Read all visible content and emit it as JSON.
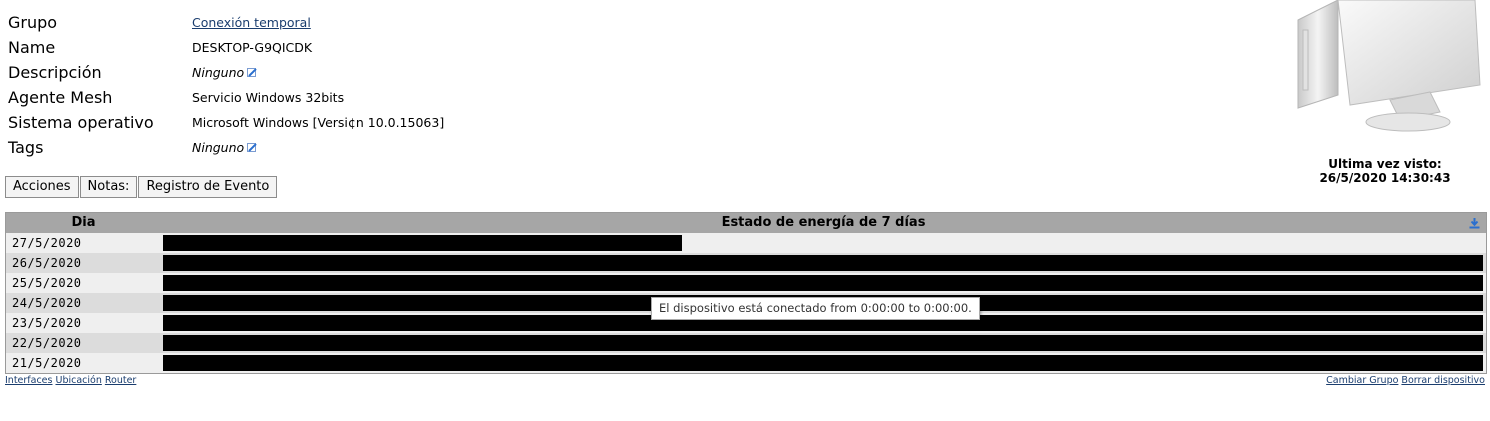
{
  "info": {
    "rows": [
      {
        "label": "Grupo",
        "value": "Conexión temporal"
      },
      {
        "label": "Name",
        "value": "DESKTOP-G9QICDK"
      },
      {
        "label": "Descripción",
        "value": "Ninguno"
      },
      {
        "label": "Agente Mesh",
        "value": "Servicio Windows 32bits"
      },
      {
        "label": "Sistema operativo",
        "value": "Microsoft Windows [Versi¢n 10.0.15063]"
      },
      {
        "label": "Tags",
        "value": "Ninguno"
      }
    ]
  },
  "device_icon": "computer-monitor-icon",
  "last_seen": {
    "label": "Ultima vez visto:",
    "value": "26/5/2020 14:30:43"
  },
  "tabs": {
    "actions": "Acciones",
    "notes": "Notas:",
    "events": "Registro de Evento"
  },
  "power": {
    "day_header": "Dia",
    "title": "Estado de energía de 7 días",
    "download_icon": "download-icon",
    "bar_color": "#000000",
    "days": [
      {
        "date": "27/5/2020",
        "on_fraction": 0.393
      },
      {
        "date": "26/5/2020",
        "on_fraction": 1.0
      },
      {
        "date": "25/5/2020",
        "on_fraction": 1.0
      },
      {
        "date": "24/5/2020",
        "on_fraction": 1.0
      },
      {
        "date": "23/5/2020",
        "on_fraction": 1.0
      },
      {
        "date": "22/5/2020",
        "on_fraction": 1.0
      },
      {
        "date": "21/5/2020",
        "on_fraction": 1.0
      }
    ]
  },
  "tooltip": "El dispositivo está conectado from 0:00:00 to 0:00:00.",
  "links_left": {
    "interfaces": "Interfaces",
    "location": "Ubicación",
    "router": "Router"
  },
  "links_right": {
    "change_group": "Cambiar Grupo",
    "delete_device": "Borrar dispositivo"
  },
  "colors": {
    "link": "#1a3d6e",
    "header_bg": "#a6a6a6",
    "row_light": "#efefef",
    "row_dark": "#dcdcdc",
    "icon_blue": "#2a6fcf"
  }
}
